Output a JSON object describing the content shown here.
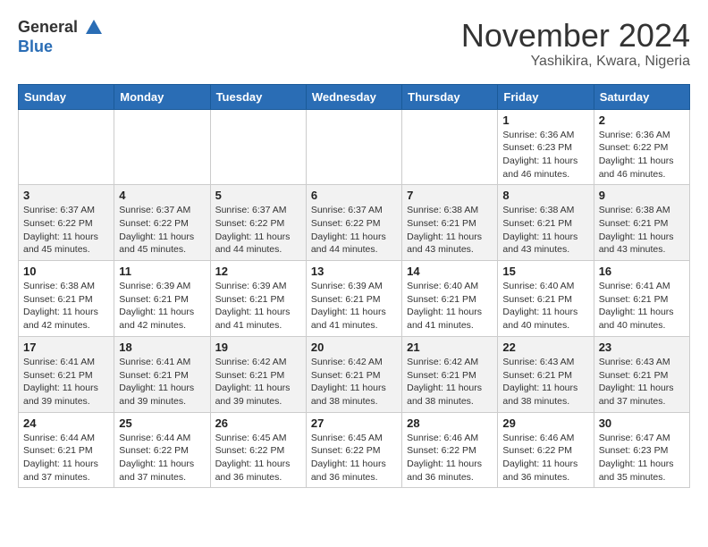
{
  "header": {
    "logo_line1": "General",
    "logo_line2": "Blue",
    "month": "November 2024",
    "location": "Yashikira, Kwara, Nigeria"
  },
  "weekdays": [
    "Sunday",
    "Monday",
    "Tuesday",
    "Wednesday",
    "Thursday",
    "Friday",
    "Saturday"
  ],
  "weeks": [
    [
      {
        "day": "",
        "info": ""
      },
      {
        "day": "",
        "info": ""
      },
      {
        "day": "",
        "info": ""
      },
      {
        "day": "",
        "info": ""
      },
      {
        "day": "",
        "info": ""
      },
      {
        "day": "1",
        "info": "Sunrise: 6:36 AM\nSunset: 6:23 PM\nDaylight: 11 hours\nand 46 minutes."
      },
      {
        "day": "2",
        "info": "Sunrise: 6:36 AM\nSunset: 6:22 PM\nDaylight: 11 hours\nand 46 minutes."
      }
    ],
    [
      {
        "day": "3",
        "info": "Sunrise: 6:37 AM\nSunset: 6:22 PM\nDaylight: 11 hours\nand 45 minutes."
      },
      {
        "day": "4",
        "info": "Sunrise: 6:37 AM\nSunset: 6:22 PM\nDaylight: 11 hours\nand 45 minutes."
      },
      {
        "day": "5",
        "info": "Sunrise: 6:37 AM\nSunset: 6:22 PM\nDaylight: 11 hours\nand 44 minutes."
      },
      {
        "day": "6",
        "info": "Sunrise: 6:37 AM\nSunset: 6:22 PM\nDaylight: 11 hours\nand 44 minutes."
      },
      {
        "day": "7",
        "info": "Sunrise: 6:38 AM\nSunset: 6:21 PM\nDaylight: 11 hours\nand 43 minutes."
      },
      {
        "day": "8",
        "info": "Sunrise: 6:38 AM\nSunset: 6:21 PM\nDaylight: 11 hours\nand 43 minutes."
      },
      {
        "day": "9",
        "info": "Sunrise: 6:38 AM\nSunset: 6:21 PM\nDaylight: 11 hours\nand 43 minutes."
      }
    ],
    [
      {
        "day": "10",
        "info": "Sunrise: 6:38 AM\nSunset: 6:21 PM\nDaylight: 11 hours\nand 42 minutes."
      },
      {
        "day": "11",
        "info": "Sunrise: 6:39 AM\nSunset: 6:21 PM\nDaylight: 11 hours\nand 42 minutes."
      },
      {
        "day": "12",
        "info": "Sunrise: 6:39 AM\nSunset: 6:21 PM\nDaylight: 11 hours\nand 41 minutes."
      },
      {
        "day": "13",
        "info": "Sunrise: 6:39 AM\nSunset: 6:21 PM\nDaylight: 11 hours\nand 41 minutes."
      },
      {
        "day": "14",
        "info": "Sunrise: 6:40 AM\nSunset: 6:21 PM\nDaylight: 11 hours\nand 41 minutes."
      },
      {
        "day": "15",
        "info": "Sunrise: 6:40 AM\nSunset: 6:21 PM\nDaylight: 11 hours\nand 40 minutes."
      },
      {
        "day": "16",
        "info": "Sunrise: 6:41 AM\nSunset: 6:21 PM\nDaylight: 11 hours\nand 40 minutes."
      }
    ],
    [
      {
        "day": "17",
        "info": "Sunrise: 6:41 AM\nSunset: 6:21 PM\nDaylight: 11 hours\nand 39 minutes."
      },
      {
        "day": "18",
        "info": "Sunrise: 6:41 AM\nSunset: 6:21 PM\nDaylight: 11 hours\nand 39 minutes."
      },
      {
        "day": "19",
        "info": "Sunrise: 6:42 AM\nSunset: 6:21 PM\nDaylight: 11 hours\nand 39 minutes."
      },
      {
        "day": "20",
        "info": "Sunrise: 6:42 AM\nSunset: 6:21 PM\nDaylight: 11 hours\nand 38 minutes."
      },
      {
        "day": "21",
        "info": "Sunrise: 6:42 AM\nSunset: 6:21 PM\nDaylight: 11 hours\nand 38 minutes."
      },
      {
        "day": "22",
        "info": "Sunrise: 6:43 AM\nSunset: 6:21 PM\nDaylight: 11 hours\nand 38 minutes."
      },
      {
        "day": "23",
        "info": "Sunrise: 6:43 AM\nSunset: 6:21 PM\nDaylight: 11 hours\nand 37 minutes."
      }
    ],
    [
      {
        "day": "24",
        "info": "Sunrise: 6:44 AM\nSunset: 6:21 PM\nDaylight: 11 hours\nand 37 minutes."
      },
      {
        "day": "25",
        "info": "Sunrise: 6:44 AM\nSunset: 6:22 PM\nDaylight: 11 hours\nand 37 minutes."
      },
      {
        "day": "26",
        "info": "Sunrise: 6:45 AM\nSunset: 6:22 PM\nDaylight: 11 hours\nand 36 minutes."
      },
      {
        "day": "27",
        "info": "Sunrise: 6:45 AM\nSunset: 6:22 PM\nDaylight: 11 hours\nand 36 minutes."
      },
      {
        "day": "28",
        "info": "Sunrise: 6:46 AM\nSunset: 6:22 PM\nDaylight: 11 hours\nand 36 minutes."
      },
      {
        "day": "29",
        "info": "Sunrise: 6:46 AM\nSunset: 6:22 PM\nDaylight: 11 hours\nand 36 minutes."
      },
      {
        "day": "30",
        "info": "Sunrise: 6:47 AM\nSunset: 6:23 PM\nDaylight: 11 hours\nand 35 minutes."
      }
    ]
  ]
}
